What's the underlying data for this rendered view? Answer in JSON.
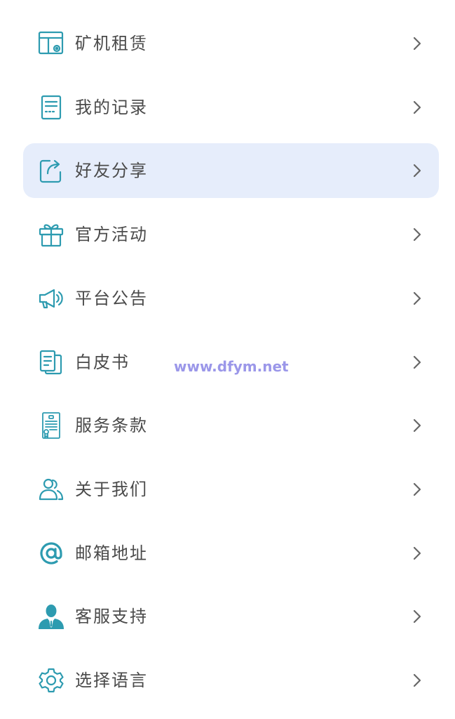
{
  "menu": {
    "items": [
      {
        "label": "矿机租赁",
        "icon": "mining-rental-icon"
      },
      {
        "label": "我的记录",
        "icon": "records-icon"
      },
      {
        "label": "好友分享",
        "icon": "share-icon",
        "active": true
      },
      {
        "label": "官方活动",
        "icon": "gift-icon"
      },
      {
        "label": "平台公告",
        "icon": "megaphone-icon"
      },
      {
        "label": "白皮书",
        "icon": "whitepaper-icon"
      },
      {
        "label": "服务条款",
        "icon": "certificate-icon"
      },
      {
        "label": "关于我们",
        "icon": "users-icon"
      },
      {
        "label": "邮箱地址",
        "icon": "at-sign-icon"
      },
      {
        "label": "客服支持",
        "icon": "support-agent-icon"
      },
      {
        "label": "选择语言",
        "icon": "gear-icon"
      }
    ]
  },
  "watermark": "www.dfym.net",
  "colors": {
    "icon_teal": "#2d9bb0",
    "active_bg": "#e6edfb",
    "label_text": "#4a4a4a",
    "chevron": "#666666",
    "watermark": "#8a86e6"
  }
}
